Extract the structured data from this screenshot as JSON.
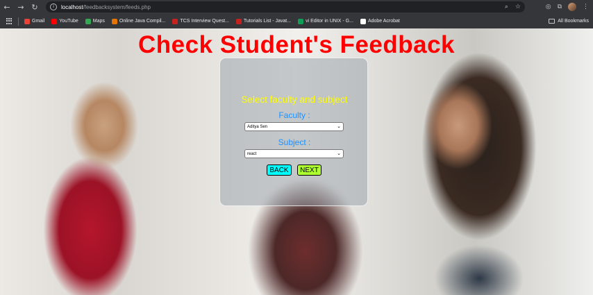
{
  "browser": {
    "url_host": "localhost",
    "url_path": "/feedbacksystem/feeds.php",
    "bookmarks": [
      {
        "label": "Gmail",
        "color": "#ea4335"
      },
      {
        "label": "YouTube",
        "color": "#ff0000"
      },
      {
        "label": "Maps",
        "color": "#34a853"
      },
      {
        "label": "Online Java Compil...",
        "color": "#e37400"
      },
      {
        "label": "TCS Interview Quest...",
        "color": "#c5221f"
      },
      {
        "label": "Tutorials List - Javat...",
        "color": "#c5221f"
      },
      {
        "label": "vi Editor in UNIX - G...",
        "color": "#0f9d58"
      },
      {
        "label": "Adobe Acrobat",
        "color": "#ffffff"
      }
    ],
    "all_bookmarks": "All Bookmarks"
  },
  "page": {
    "title": "Check Student's Feedback",
    "panel_heading": "Select faculty and subject",
    "faculty_label": "Faculty :",
    "faculty_value": "Aditya Sen",
    "subject_label": "Subject :",
    "subject_value": "react",
    "back_label": "BACK",
    "next_label": "NEXT"
  },
  "colors": {
    "title": "#ff0000",
    "heading": "#ffff00",
    "labels": "#1e90ff",
    "back_button": "#00ffff",
    "next_button": "#adff2f"
  }
}
